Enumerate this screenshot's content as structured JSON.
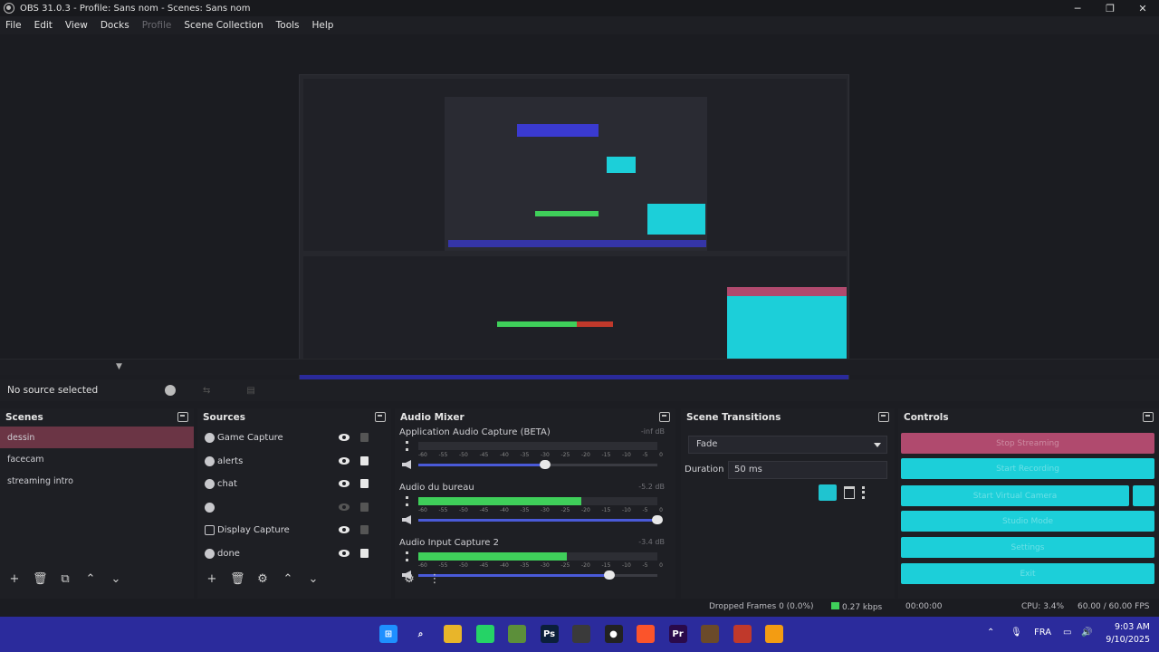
{
  "window": {
    "title": "OBS 31.0.3 - Profile: Sans nom - Scenes: Sans nom",
    "minimize": "─",
    "maximize": "❐",
    "close": "✕"
  },
  "menu": {
    "items": [
      "File",
      "Edit",
      "View",
      "Docks",
      "Profile",
      "Scene Collection",
      "Tools",
      "Help"
    ]
  },
  "source_bar": {
    "label": "No source selected"
  },
  "scenes": {
    "title": "Scenes",
    "items": [
      "dessin",
      "facecam",
      "streaming intro"
    ],
    "active_index": 0,
    "footer": [
      "+",
      "🗑",
      "⧉",
      "⌃",
      "⌄"
    ]
  },
  "sources": {
    "title": "Sources",
    "items": [
      {
        "name": "Game Capture",
        "visible": true,
        "locked": false
      },
      {
        "name": "alerts",
        "visible": true,
        "locked": true
      },
      {
        "name": "chat",
        "visible": true,
        "locked": true
      },
      {
        "name": "",
        "visible": false,
        "locked": false
      },
      {
        "name": "Display Capture",
        "visible": true,
        "locked": false
      },
      {
        "name": "done",
        "visible": true,
        "locked": true
      }
    ],
    "footer": [
      "+",
      "🗑",
      "⚙",
      "⌃",
      "⌄"
    ]
  },
  "mixer": {
    "title": "Audio Mixer",
    "channels": [
      {
        "name": "Application Audio Capture (BETA)",
        "db": "-inf dB",
        "level": 0,
        "volume": 0.53
      },
      {
        "name": "Audio du bureau",
        "db": "-5.2 dB",
        "level": 0.68,
        "volume": 1.0
      },
      {
        "name": "Audio Input Capture 2",
        "db": "-3.4 dB",
        "level": 0.62,
        "volume": 0.8
      }
    ],
    "ticks": [
      "-60",
      "-55",
      "-50",
      "-45",
      "-40",
      "-35",
      "-30",
      "-25",
      "-20",
      "-15",
      "-10",
      "-5",
      "0"
    ],
    "footer": [
      "⚙",
      "⋮"
    ]
  },
  "transitions": {
    "title": "Scene Transitions",
    "selected": "Fade",
    "duration_label": "Duration",
    "duration_value": "50 ms"
  },
  "controls": {
    "title": "Controls",
    "buttons": [
      "Stop Streaming",
      "Start Recording",
      "Start Virtual Camera",
      "Studio Mode",
      "Settings",
      "Exit"
    ]
  },
  "status": {
    "dropped": "Dropped Frames 0 (0.0%)",
    "bitrate": "0.27 kbps",
    "rec_time": "00:00:00",
    "cpu": "CPU: 3.4%",
    "fps": "60.00 / 60.00 FPS"
  },
  "taskbar": {
    "language": "FRA",
    "time": "9:03 AM",
    "date": "9/10/2025",
    "apps": [
      {
        "icon": "windows-start-icon",
        "color": "#1e90ff",
        "glyph": "⊞"
      },
      {
        "icon": "search-icon",
        "color": "transparent",
        "glyph": "⌕"
      },
      {
        "icon": "file-explorer-icon",
        "color": "#e8b52a",
        "glyph": ""
      },
      {
        "icon": "whatsapp-icon",
        "color": "#25d366",
        "glyph": ""
      },
      {
        "icon": "minecraft-icon",
        "color": "#5c8f3a",
        "glyph": ""
      },
      {
        "icon": "photoshop-icon",
        "color": "#0b1f3a",
        "glyph": "Ps"
      },
      {
        "icon": "snipping-tool-icon",
        "color": "#3a3a3a",
        "glyph": ""
      },
      {
        "icon": "obs-icon",
        "color": "#222",
        "glyph": "●"
      },
      {
        "icon": "brave-icon",
        "color": "#fb542b",
        "glyph": ""
      },
      {
        "icon": "premiere-icon",
        "color": "#2a0a4a",
        "glyph": "Pr"
      },
      {
        "icon": "game-icon",
        "color": "#6b4a2a",
        "glyph": ""
      },
      {
        "icon": "app-icon",
        "color": "#c0392b",
        "glyph": ""
      },
      {
        "icon": "vlc-icon",
        "color": "#f39c12",
        "glyph": ""
      }
    ]
  },
  "colors": {
    "accent_teal": "#1ccfd9",
    "accent_pink": "#b04a6e",
    "taskbar": "#2b2b9c",
    "meter_green": "#3fcf5a"
  }
}
